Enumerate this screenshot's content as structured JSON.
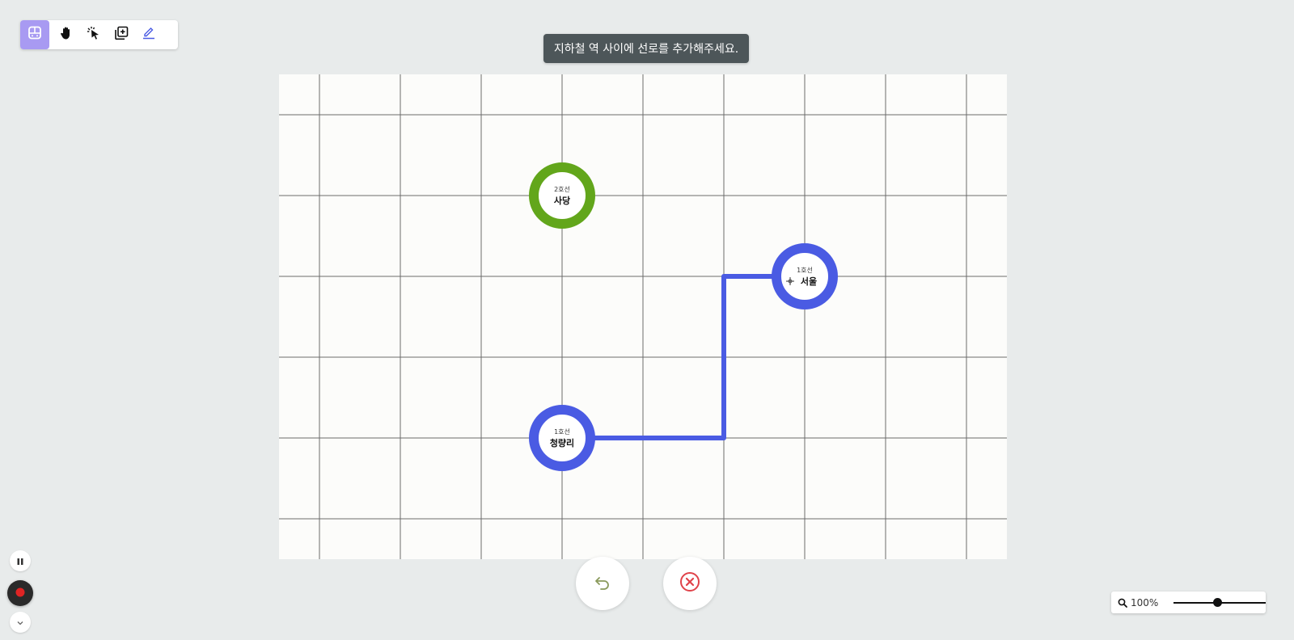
{
  "toolbar": {
    "tools": [
      {
        "icon": "subway-icon",
        "active": true
      },
      {
        "icon": "hand-icon",
        "active": false
      },
      {
        "icon": "pointer-sparkle-icon",
        "active": false
      },
      {
        "icon": "add-layer-icon",
        "active": false
      },
      {
        "icon": "pen-icon",
        "active": false
      }
    ],
    "accent": "#a89af2"
  },
  "tooltip": {
    "text": "지하철 역 사이에 선로를 추가해주세요."
  },
  "stations": {
    "sadang": {
      "line": "2호선",
      "name": "사당",
      "color": "#62a61b"
    },
    "seoul": {
      "line": "1호선",
      "name": "서울",
      "color": "#4a5be3"
    },
    "cheongnyangni": {
      "line": "1호선",
      "name": "청량리",
      "color": "#4a5be3"
    }
  },
  "track": {
    "color": "#4a5be3",
    "from": "청량리",
    "to": "서울"
  },
  "controls": {
    "undo_icon": "undo-arrow-icon",
    "undo_color": "#8a9a5b",
    "cancel_icon": "close-circle-icon",
    "cancel_color": "#e0434a"
  },
  "side": {
    "pause_icon": "pause-icon",
    "record_icon": "record-icon",
    "record_color": "#e02424",
    "collapse_icon": "chevron-down-icon"
  },
  "zoom": {
    "label": "100%",
    "level": 0.48
  }
}
